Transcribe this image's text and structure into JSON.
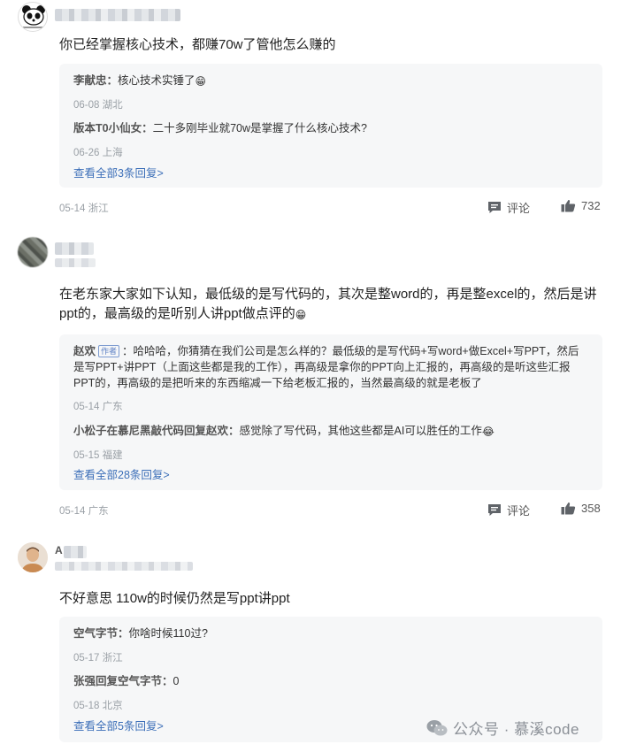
{
  "comments": [
    {
      "text": "你已经掌握核心技术，都赚70w了管他怎么赚的",
      "replies": [
        {
          "author": "李献忠：",
          "text": "核心技术实锤了",
          "meta": "06-08 湖北"
        },
        {
          "author": "版本T0小仙女：",
          "text": "二十多刚毕业就70w是掌握了什么核心技术?",
          "meta": "06-26 上海"
        }
      ],
      "view_all": "查看全部3条回复>",
      "date": "05-14 浙江",
      "comment_label": "评论",
      "likes": "732"
    },
    {
      "text": "在老东家大家如下认知，最低级的是写代码的，其次是整word的，再是整excel的，然后是讲ppt的，最高级的是听别人讲ppt做点评的",
      "replies": [
        {
          "author": "赵欢",
          "badge": "作者",
          "text": "：哈哈哈，你猜猜在我们公司是怎么样的？最低级的是写代码+写word+做Excel+写PPT，然后是写PPT+讲PPT（上面这些都是我的工作），再高级是拿你的PPT向上汇报的，再高级的是听这些汇报PPT的，再高级的是把听来的东西缩减一下给老板汇报的，当然最高级的就是老板了",
          "meta": "05-14 广东"
        },
        {
          "author": "小松子在慕尼黑敲代码回复赵欢：",
          "text": "感觉除了写代码，其他这些都是AI可以胜任的工作",
          "meta": "05-15 福建"
        }
      ],
      "view_all": "查看全部28条回复>",
      "date": "05-14 广东",
      "comment_label": "评论",
      "likes": "358"
    },
    {
      "user_partial": "A",
      "text": "不好意思 110w的时候仍然是写ppt讲ppt",
      "replies": [
        {
          "author": "空气字节：",
          "text": "你啥时候110过?",
          "meta": "05-17 浙江"
        },
        {
          "author": "张强回复空气字节：",
          "text": "0",
          "meta": "05-18 北京"
        }
      ],
      "view_all": "查看全部5条回复>"
    }
  ],
  "watermark": "公众号 · 慕溪code",
  "colors": {
    "link": "#3c6fb8",
    "reply_bg": "#f6f7f8",
    "meta": "#9aa0a6"
  }
}
